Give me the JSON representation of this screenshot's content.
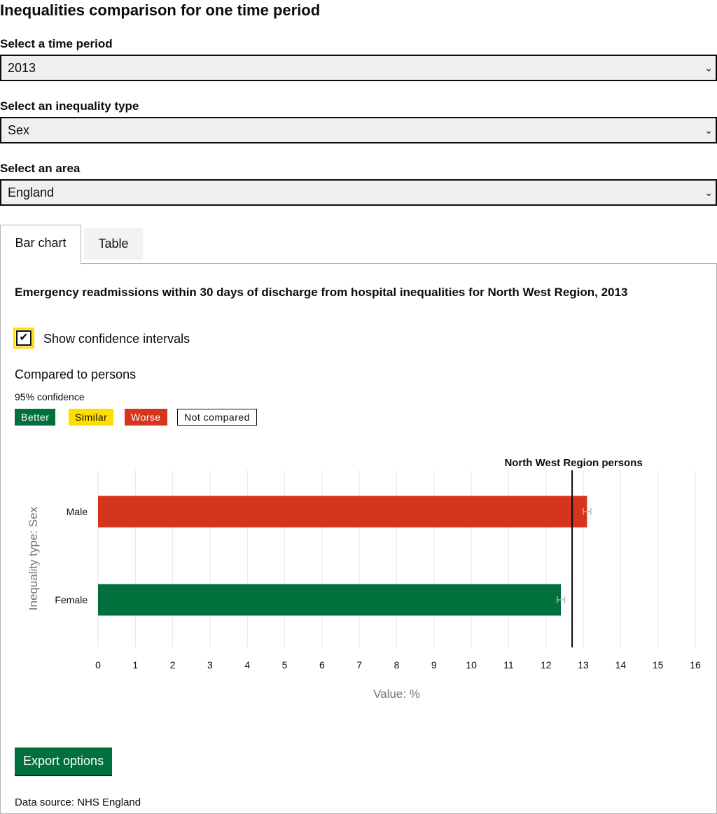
{
  "page": {
    "title": "Inequalities comparison for one time period"
  },
  "filters": {
    "time_period": {
      "label": "Select a time period",
      "value": "2013"
    },
    "inequality_type": {
      "label": "Select an inequality type",
      "value": "Sex"
    },
    "area": {
      "label": "Select an area",
      "value": "England"
    }
  },
  "tabs": [
    {
      "label": "Bar chart"
    },
    {
      "label": "Table"
    }
  ],
  "panel": {
    "chart_title": "Emergency readmissions within 30 days of discharge from hospital inequalities for North West Region, 2013",
    "checkbox_label": "Show confidence intervals",
    "compared_to": "Compared to persons",
    "confidence": "95% confidence",
    "legend": {
      "better": "Better",
      "similar": "Similar",
      "worse": "Worse",
      "not_compared": "Not compared"
    },
    "export_label": "Export options",
    "data_source": "Data source: NHS England"
  },
  "colors": {
    "better": "#00703c",
    "similar": "#ffdd00",
    "worse": "#d4351c",
    "ci": "#b1b4b6"
  },
  "chart_data": {
    "type": "bar",
    "orientation": "horizontal",
    "categories": [
      "Male",
      "Female"
    ],
    "values": [
      13.1,
      12.4
    ],
    "ci_lower": [
      13.0,
      12.3
    ],
    "ci_upper": [
      13.2,
      12.5
    ],
    "comparison": [
      "worse",
      "better"
    ],
    "reference": {
      "label": "North West Region persons",
      "value": 12.7
    },
    "xlabel": "Value: %",
    "ylabel": "Inequality type: Sex",
    "xlim": [
      0,
      16
    ],
    "xticks": [
      0,
      1,
      2,
      3,
      4,
      5,
      6,
      7,
      8,
      9,
      10,
      11,
      12,
      13,
      14,
      15,
      16
    ],
    "grid": true
  }
}
